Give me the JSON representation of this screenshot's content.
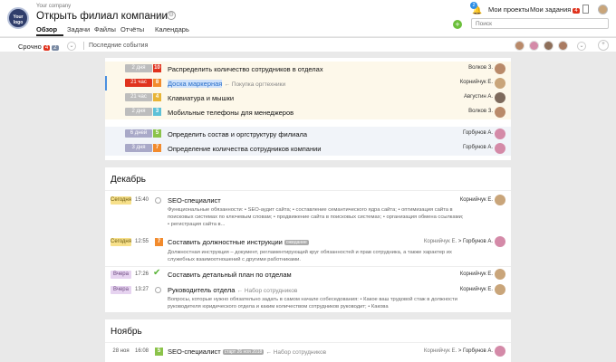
{
  "header": {
    "company": "Your company",
    "title": "Открыть филиал компании",
    "logo_text": "Your logo",
    "tabs": [
      {
        "label": "Обзор"
      },
      {
        "label": "Задачи"
      },
      {
        "label": "Файлы"
      },
      {
        "label": "Отчёты"
      },
      {
        "label": "Календарь"
      }
    ],
    "bell_badge": "2",
    "my_projects": "Мои проекты",
    "my_tasks": "Мои задания",
    "my_tasks_count": "4",
    "search_placeholder": "Поиск"
  },
  "subbar": {
    "urgent_label": "Срочно",
    "urgent_red": "4",
    "urgent_blue": "2",
    "last_events": "Последние события"
  },
  "urgent_tasks": [
    {
      "tag": "2 дня",
      "tag_color": "#bdbdbd",
      "priority": "10",
      "priority_color": "#e0331e",
      "title": "Распределить количество сотрудников в отделах",
      "assignee": "Волков З."
    },
    {
      "tag": "21 час",
      "tag_color": "#e0331e",
      "priority": "8",
      "priority_color": "#f28b2d",
      "title": "Доска маркерная",
      "note": "← Покупка оргтехники",
      "assignee": "Корнийчук Е."
    },
    {
      "tag": "21 час",
      "tag_color": "#bdbdbd",
      "priority": "4",
      "priority_color": "#e8b537",
      "title": "Клавиатура и мышки",
      "assignee": "Августин А."
    },
    {
      "tag": "2 дня",
      "tag_color": "#bdbdbd",
      "priority": "3",
      "priority_color": "#5ec1d8",
      "title": "Мобильные телефоны для менеджеров",
      "assignee": "Волков З."
    }
  ],
  "blue_tasks": [
    {
      "tag": "6 дней",
      "tag_color": "#a9a9c8",
      "priority": "5",
      "priority_color": "#8bc34a",
      "title": "Определить состав и оргструктуру филиала",
      "assignee": "Горбунов А."
    },
    {
      "tag": "3 дня",
      "tag_color": "#a9a9c8",
      "priority": "7",
      "priority_color": "#f28b2d",
      "title": "Определение количества сотрудников компании",
      "assignee": "Горбунов А."
    }
  ],
  "december": {
    "heading": "Декабрь",
    "items": [
      {
        "day": "Сегодня",
        "time": "15:40",
        "title": "SEO-специалист",
        "who": "Корнийчук Е.",
        "desc": "Функциональные обязанности: • SEO-аудит сайта; • составление семантического ядра сайта; • оптимизация сайта в поисковых системах по ключевым словам; • продвижение сайта в поисковых системах; • организация обмена ссылками; • регистрация сайта в..."
      },
      {
        "day": "Сегодня",
        "time": "12:55",
        "priority": "7",
        "title": "Составить должностные инструкции",
        "pill": "ожидание",
        "who_from": "Корнийчук Е.",
        "who_to": "Горбунов А.",
        "desc": "Должностная инструкция – документ, регламентирующий круг обязанностей и прав сотрудника, а также характер их служебных взаимоотношений с другими работниками."
      },
      {
        "day": "Вчера",
        "time": "17:26",
        "title": "Составить детальный план по отделам",
        "who": "Корнийчук Е."
      },
      {
        "day": "Вчера",
        "time": "13:27",
        "title": "Руководитель отдела",
        "note": "← Набор сотрудников",
        "who": "Корнийчук Е.",
        "desc": "Вопросы, которые нужно обязательно задать в самом начале собеседования: • Какое ваш трудовой стаж в должности руководителя юридического отдела и каким количеством сотрудников руководит; • Какова"
      }
    ]
  },
  "november": {
    "heading": "Ноябрь",
    "items": [
      {
        "day": "28 ноя",
        "time": "16:08",
        "priority": "5",
        "title": "SEO-специалист",
        "pill": "старт 26 ноя 2018",
        "note": "← Набор сотрудников",
        "who_from": "Корнийчук Е.",
        "who_to": "Горбунов А."
      }
    ]
  }
}
